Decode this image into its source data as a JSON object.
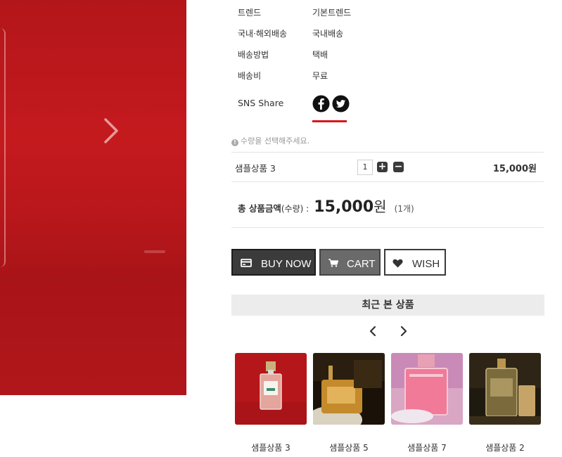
{
  "hero": {
    "next_icon": "chevron-right-icon"
  },
  "info": [
    {
      "label": "트렌드",
      "value": "기본트렌드"
    },
    {
      "label": "국내·해외배송",
      "value": "국내배송"
    },
    {
      "label": "배송방법",
      "value": "택배"
    },
    {
      "label": "배송비",
      "value": "무료"
    }
  ],
  "sns": {
    "label": "SNS Share",
    "icons": [
      "facebook-icon",
      "twitter-icon"
    ],
    "accent": "#d8161b"
  },
  "notice": "수량을 선택해주세요.",
  "option": {
    "name": "샘플상품 3",
    "quantity": "1",
    "price": "15,000원"
  },
  "total": {
    "label": "총 상품금액",
    "sub": "(수량) :",
    "amount": "15,000",
    "unit": "원",
    "count": "(1개)"
  },
  "buttons": {
    "buy": "BUY NOW",
    "cart": "CART",
    "wish": "WISH"
  },
  "recent": {
    "title": "최근 본 상품",
    "items": [
      {
        "name": "샘플상품 3"
      },
      {
        "name": "샘플상품 5"
      },
      {
        "name": "샘플상품 7"
      },
      {
        "name": "샘플상품 2"
      }
    ]
  },
  "colors": {
    "hero_red": "#b8171b",
    "dark_button": "#3b3b3b",
    "grey_button": "#6a6a6a"
  }
}
